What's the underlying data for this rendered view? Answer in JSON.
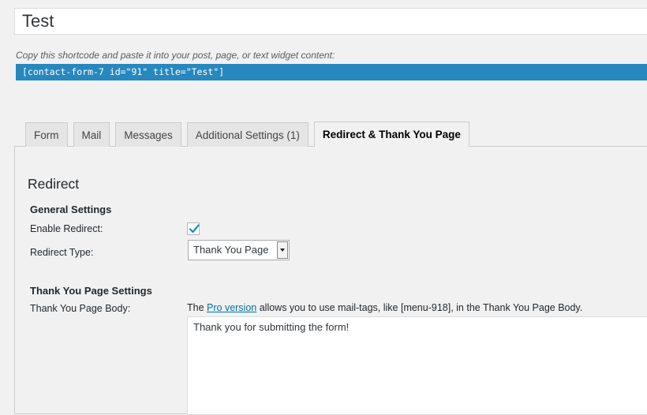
{
  "title_field": {
    "value": "Test"
  },
  "shortcode": {
    "hint": "Copy this shortcode and paste it into your post, page, or text widget content:",
    "code": "[contact-form-7 id=\"91\" title=\"Test\"]"
  },
  "tabs": [
    {
      "label": "Form"
    },
    {
      "label": "Mail"
    },
    {
      "label": "Messages"
    },
    {
      "label": "Additional Settings (1)"
    },
    {
      "label": "Redirect & Thank You Page",
      "active": true
    }
  ],
  "redirect": {
    "title": "Redirect",
    "general_settings": "General Settings",
    "enable_label": "Enable Redirect:",
    "enable_checked": true,
    "type_label": "Redirect Type:",
    "type_value": "Thank You Page"
  },
  "thank_you": {
    "heading": "Thank You Page Settings",
    "body_label": "Thank You Page Body:",
    "desc_prefix": "The ",
    "desc_link": "Pro version",
    "desc_suffix": " allows you to use mail-tags, like [menu-918], in the Thank You Page Body.",
    "body_value": "Thank you for submitting the form!"
  },
  "colors": {
    "shortcode_bg": "#2688be",
    "link": "#0073aa",
    "check": "#1e8cbe"
  }
}
